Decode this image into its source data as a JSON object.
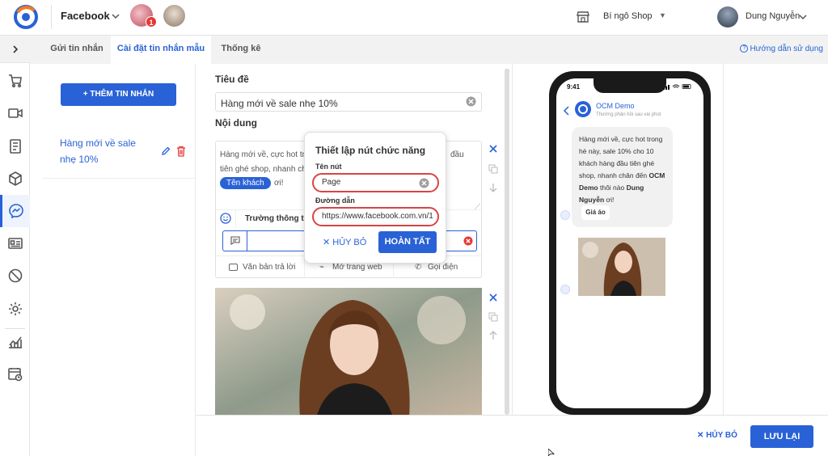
{
  "topbar": {
    "channel": "Facebook",
    "notification_count": "1",
    "shop_name": "Bí ngô Shop",
    "user_name": "Dung Nguyễn"
  },
  "tabs": [
    {
      "label": "Gửi tin nhắn",
      "active": false
    },
    {
      "label": "Cài đặt tin nhắn mẫu",
      "active": true
    },
    {
      "label": "Thống kê",
      "active": false
    }
  ],
  "guide_label": "Hướng dẫn sử dụng",
  "list": {
    "add_label": "+ THÊM TIN NHẮN",
    "items": [
      {
        "label": "Hàng mới về sale nhẹ 10%"
      }
    ]
  },
  "editor": {
    "title_label": "Tiêu đề",
    "title_value": "Hàng mới về sale nhẹ 10%",
    "content_label": "Nội dung",
    "content_text": "Hàng mới về, cực hot tr                                              đầu tiên ghé shop, nhanh ch",
    "content_text_l1a": "Hàng mới về, cực hot tr",
    "content_text_l1b": "đầu",
    "content_text_l2": "tiên ghé shop, nhanh ch",
    "chip_label": "Tên khách",
    "chip_suffix": "ơi!",
    "fields_label": "Trường thông tin",
    "button_types": [
      "Văn bản trả lời",
      "Mở trang web",
      "Gọi điện"
    ]
  },
  "popup": {
    "title": "Thiết lập nút chức năng",
    "name_label": "Tên nút",
    "name_value": "Page",
    "url_label": "Đường dẫn",
    "url_value": "https://www.facebook.com.vn/1",
    "cancel_label": "✕  HỦY BỎ",
    "done_label": "HOÀN TẤT"
  },
  "preview": {
    "time": "9:41",
    "page_name": "OCM Demo",
    "page_status": "Thường phản hồi sau vài phút",
    "bubble_pre": "Hàng mới về, cực hot trong hè này, sale 10% cho 10 khách hàng đầu tiên ghé shop, nhanh chân đến ",
    "bubble_brand": "OCM Demo",
    "bubble_mid": " thôi nào ",
    "bubble_name": "Dung Nguyễn",
    "bubble_post": " ơi!",
    "button_label": "Giá áo"
  },
  "footer": {
    "cancel_label": "✕ HỦY BỎ",
    "save_label": "LƯU LẠI"
  },
  "colors": {
    "accent": "#2962d6",
    "danger": "#e53935",
    "highlight_ring": "#d64545"
  }
}
